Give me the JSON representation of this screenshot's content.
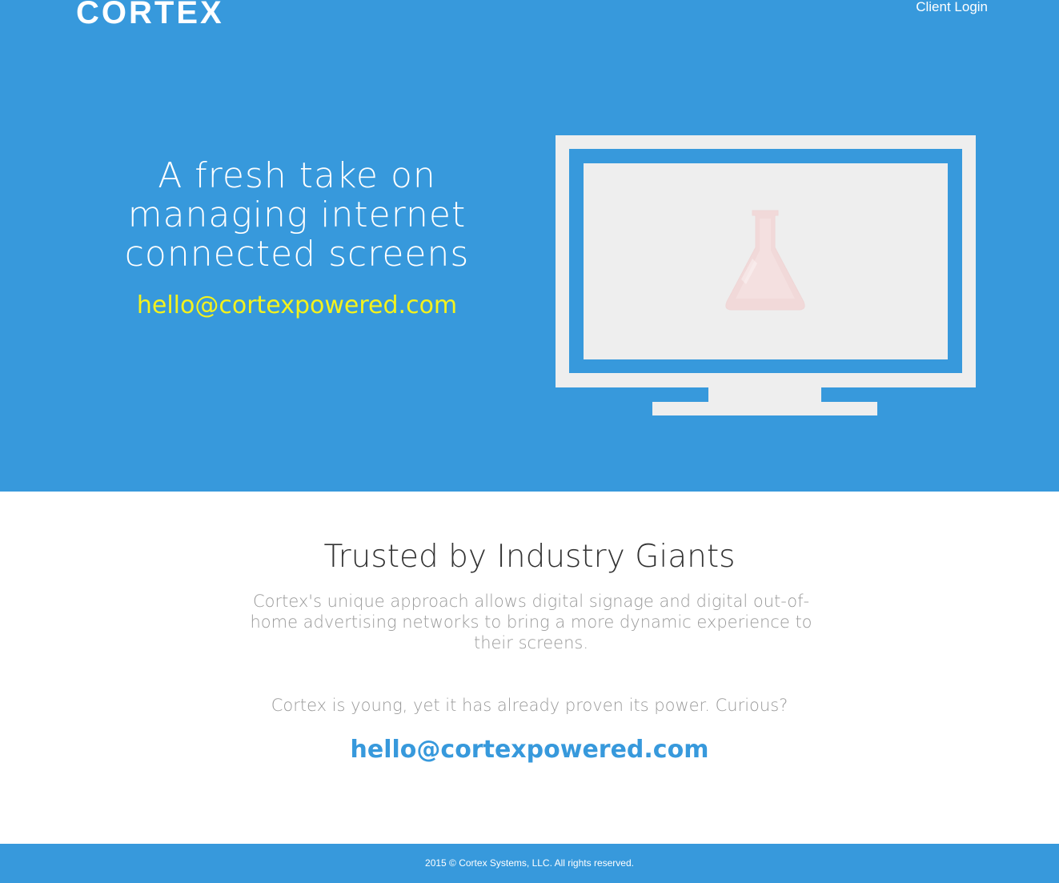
{
  "header": {
    "logo": "CORTEX",
    "client_login": "Client Login"
  },
  "hero": {
    "title": "A fresh take on managing internet connected screens",
    "email": "hello@cortexpowered.com",
    "illustration_icon": "flask-icon"
  },
  "section": {
    "title": "Trusted by Industry Giants",
    "paragraph": "Cortex's unique approach allows digital signage and digital out-of-home advertising networks to bring a more dynamic experience to their screens.",
    "curious": "Cortex is young, yet it has already proven its power. Curious?",
    "email": "hello@cortexpowered.com"
  },
  "footer": {
    "copyright": "2015 © Cortex Systems, LLC. All rights reserved."
  },
  "colors": {
    "brand_blue": "#3799dc",
    "accent_yellow": "#f4f21c",
    "screen_gray": "#eeeeee",
    "flask_pink": "#f1d9d9"
  }
}
